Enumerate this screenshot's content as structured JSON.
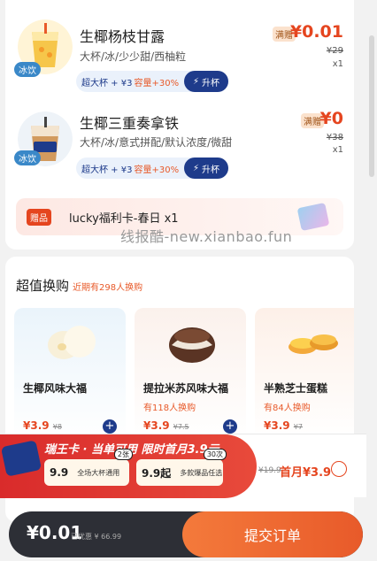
{
  "order": {
    "items": [
      {
        "name": "生椰杨枝甘露",
        "spec": "大杯/冰/少少甜/西柚粒",
        "iced_tag": "冰饮",
        "upgrade_text": "超大杯 + ¥3",
        "upgrade_capacity": "容量+30%",
        "upgrade_button": "升杯",
        "badge": "满赠",
        "price": "¥0.01",
        "original_price": "¥29",
        "quantity": "x1"
      },
      {
        "name": "生椰三重奏拿铁",
        "spec": "大杯/冰/意式拼配/默认浓度/微甜",
        "iced_tag": "冰饮",
        "upgrade_text": "超大杯 + ¥3",
        "upgrade_capacity": "容量+30%",
        "upgrade_button": "升杯",
        "badge": "满赠",
        "price": "¥0",
        "original_price": "¥38",
        "quantity": "x1"
      }
    ],
    "gift": {
      "tag": "赠品",
      "name": "lucky福利卡-春日 x1"
    }
  },
  "watermark": "线报酷-new.xianbao.fun",
  "deals": {
    "title": "超值换购",
    "subtitle": "近期有298人换购",
    "items": [
      {
        "name": "生椰风味大福",
        "sold": "",
        "price": "¥3.9",
        "original": "¥8"
      },
      {
        "name": "提拉米苏风味大福",
        "sold": "有118人换购",
        "price": "¥3.9",
        "original": "¥7.5"
      },
      {
        "name": "半熟芝士蛋糕",
        "sold": "有84人换购",
        "price": "¥3.9",
        "original": "¥7"
      }
    ]
  },
  "promo": {
    "title": "瑞王卡 · 当单可用  限时首月3.9元",
    "tiles": [
      {
        "big": "9.9",
        "small": "全场大杯通用",
        "count": "2张"
      },
      {
        "big": "9.9起",
        "small": "多款爆品任选",
        "count": "30次"
      }
    ],
    "original_price": "¥19.9",
    "price": "首月¥3.9"
  },
  "checkout": {
    "total": "¥0.01",
    "discount": "已优惠 ¥ 66.99",
    "submit": "提交订单"
  },
  "colors": {
    "accent": "#e5451f",
    "brand_blue": "#1e3b8b"
  }
}
